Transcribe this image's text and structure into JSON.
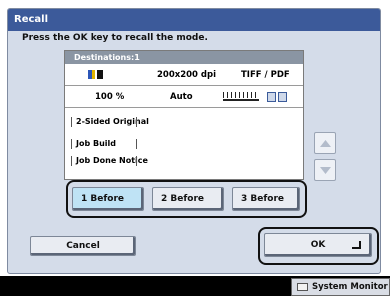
{
  "dialog": {
    "title": "Recall",
    "instruction": "Press the OK key to recall the mode."
  },
  "panel": {
    "destinations_label": "Destinations:1",
    "resolution": "200x200 dpi",
    "file_format": "TIFF / PDF",
    "scale": "100 %",
    "image_mode": "Auto",
    "settings": [
      "2-Sided Original",
      "Job Build",
      "Job Done Notice"
    ]
  },
  "before_buttons": [
    {
      "label": "1 Before",
      "selected": true
    },
    {
      "label": "2 Before",
      "selected": false
    },
    {
      "label": "3 Before",
      "selected": false
    }
  ],
  "actions": {
    "cancel_label": "Cancel",
    "ok_label": "OK"
  },
  "status_bar": {
    "system_monitor_label": "System Monitor"
  },
  "colors": {
    "title_bar": "#3c5a9a",
    "dialog_bg": "#d4dce9",
    "selected_button": "#bfe3f5"
  }
}
